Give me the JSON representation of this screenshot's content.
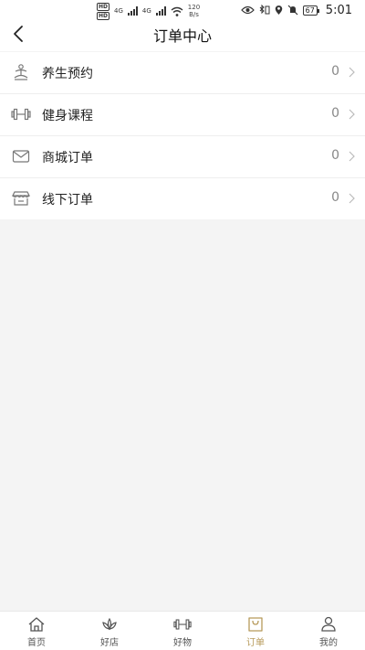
{
  "status_bar": {
    "sim1": "HD",
    "sim2": "HD",
    "net1": "4G",
    "net2": "4G",
    "speed_value": "120",
    "speed_unit": "B/s",
    "battery": "67",
    "time": "5:01"
  },
  "header": {
    "title": "订单中心"
  },
  "orders": [
    {
      "label": "养生预约",
      "count": "0",
      "icon": "meditation-icon"
    },
    {
      "label": "健身课程",
      "count": "0",
      "icon": "dumbbell-icon"
    },
    {
      "label": "商城订单",
      "count": "0",
      "icon": "mail-icon"
    },
    {
      "label": "线下订单",
      "count": "0",
      "icon": "store-icon"
    }
  ],
  "tabs": [
    {
      "label": "首页",
      "icon": "home-icon",
      "active": false
    },
    {
      "label": "好店",
      "icon": "lotus-icon",
      "active": false
    },
    {
      "label": "好物",
      "icon": "dumbbell-icon",
      "active": false
    },
    {
      "label": "订单",
      "icon": "shopping-bag-icon",
      "active": true
    },
    {
      "label": "我的",
      "icon": "user-icon",
      "active": false
    }
  ],
  "colors": {
    "accent": "#b79a5a",
    "background": "#f4f4f4"
  }
}
